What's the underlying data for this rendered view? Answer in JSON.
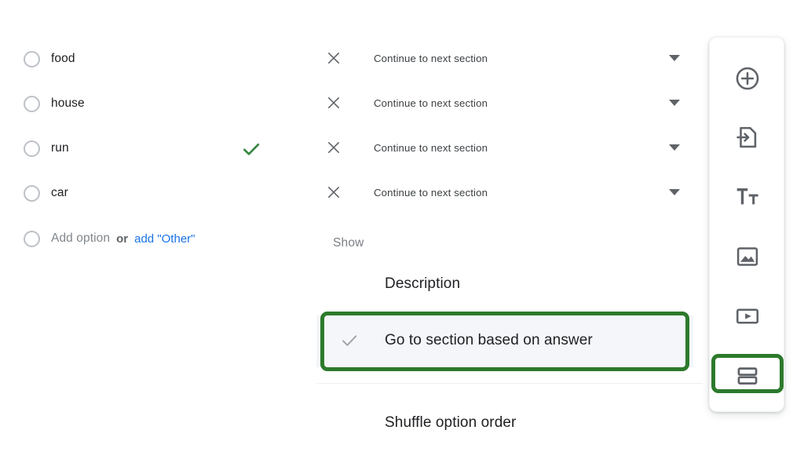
{
  "options": {
    "items": [
      {
        "label": "food",
        "correct": false
      },
      {
        "label": "house",
        "correct": false
      },
      {
        "label": "run",
        "correct": true
      },
      {
        "label": "car",
        "correct": false
      }
    ],
    "add_option_label": "Add option",
    "or_label": "or",
    "add_other_label": "add \"Other\"",
    "correct_mark_color": "#34853f",
    "other_link_color": "#1a73e8"
  },
  "branching": {
    "rows": [
      {
        "action": "Continue to next section"
      },
      {
        "action": "Continue to next section"
      },
      {
        "action": "Continue to next section"
      },
      {
        "action": "Continue to next section"
      }
    ]
  },
  "show_menu": {
    "group_label": "Show",
    "items": [
      {
        "label": "Description",
        "checked": false,
        "highlighted": false
      },
      {
        "label": "Go to section based on answer",
        "checked": true,
        "highlighted": true
      },
      {
        "label": "Shuffle option order",
        "checked": false,
        "highlighted": false
      }
    ],
    "highlight_color": "#2d7a2c",
    "selected_row_background": "#f4f6f9"
  },
  "toolbar": {
    "buttons": [
      {
        "icon": "add-question-icon",
        "name": "Add question"
      },
      {
        "icon": "import-questions-icon",
        "name": "Import questions"
      },
      {
        "icon": "add-title-icon",
        "name": "Add title and description"
      },
      {
        "icon": "add-image-icon",
        "name": "Add image"
      },
      {
        "icon": "add-video-icon",
        "name": "Add video"
      },
      {
        "icon": "add-section-icon",
        "name": "Add section"
      }
    ],
    "highlighted_button_index": 5,
    "highlight_color": "#2d7a2c"
  }
}
